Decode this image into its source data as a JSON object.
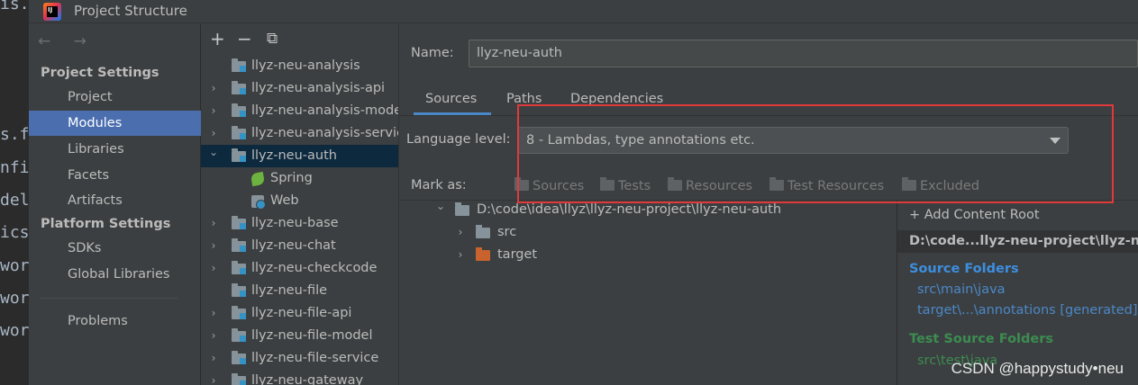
{
  "editor": {
    "lines": [
      "is.",
      "s.f",
      "nfi",
      "del",
      "ics",
      "wor",
      "wor",
      "wor"
    ]
  },
  "window": {
    "title": "Project Structure",
    "icon": "intellij-idea-icon"
  },
  "nav": {
    "arrows": "← →",
    "project_settings": "Project Settings",
    "project_items": [
      "Project",
      "Modules",
      "Libraries",
      "Facets",
      "Artifacts"
    ],
    "selected": "Modules",
    "platform_settings": "Platform Settings",
    "platform_items": [
      "SDKs",
      "Global Libraries"
    ],
    "problems": "Problems"
  },
  "tree": {
    "toolbar": {
      "add": "+",
      "remove": "−",
      "copy": "⧉"
    },
    "rows": [
      {
        "label": "llyz-neu-analysis",
        "expander": "",
        "kind": "module"
      },
      {
        "label": "llyz-neu-analysis-api",
        "expander": "›",
        "kind": "module"
      },
      {
        "label": "llyz-neu-analysis-mode",
        "expander": "›",
        "kind": "module"
      },
      {
        "label": "llyz-neu-analysis-servic",
        "expander": "›",
        "kind": "module"
      },
      {
        "label": "llyz-neu-auth",
        "expander": "⌄",
        "kind": "module",
        "selected": true
      },
      {
        "label": "Spring",
        "expander": "",
        "kind": "spring"
      },
      {
        "label": "Web",
        "expander": "",
        "kind": "web"
      },
      {
        "label": "llyz-neu-base",
        "expander": "›",
        "kind": "module"
      },
      {
        "label": "llyz-neu-chat",
        "expander": "›",
        "kind": "module"
      },
      {
        "label": "llyz-neu-checkcode",
        "expander": "›",
        "kind": "module"
      },
      {
        "label": "llyz-neu-file",
        "expander": "",
        "kind": "module"
      },
      {
        "label": "llyz-neu-file-api",
        "expander": "›",
        "kind": "module"
      },
      {
        "label": "llyz-neu-file-model",
        "expander": "›",
        "kind": "module"
      },
      {
        "label": "llyz-neu-file-service",
        "expander": "›",
        "kind": "module"
      },
      {
        "label": "llyz-neu-gateway",
        "expander": "›",
        "kind": "module"
      }
    ]
  },
  "detail": {
    "name_label": "Name:",
    "name_value": "llyz-neu-auth",
    "tabs": [
      "Sources",
      "Paths",
      "Dependencies"
    ],
    "active_tab": "Sources",
    "language_level_label": "Language level:",
    "language_level_value": "8 - Lambdas, type annotations etc.",
    "mark_as_label": "Mark as:",
    "mark_as": [
      "Sources",
      "Tests",
      "Resources",
      "Test Resources",
      "Excluded"
    ],
    "content_tree": [
      {
        "label": "D:\\code\\idea\\llyz\\llyz-neu-project\\llyz-neu-auth",
        "expander": "⌄"
      },
      {
        "label": "src",
        "expander": "›"
      },
      {
        "label": "target",
        "expander": "›"
      }
    ],
    "roots": {
      "add_content_root": "+ Add Content Root",
      "root_path": "D:\\code...llyz-neu-project\\llyz-neu-au",
      "source_folders_title": "Source Folders",
      "source_folders": [
        "src\\main\\java",
        "target\\...\\annotations [generated]"
      ],
      "test_source_folders_title": "Test Source Folders",
      "test_source_folders": [
        "src\\test\\java"
      ]
    }
  },
  "highlight_color": "#e0393a",
  "watermark": "CSDN @happystudy•neu"
}
